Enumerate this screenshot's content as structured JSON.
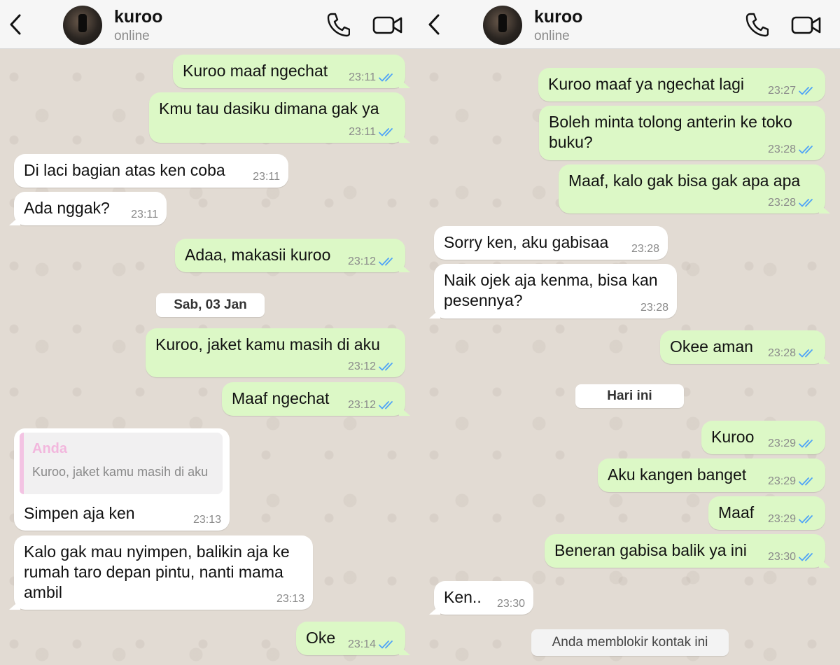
{
  "contact": {
    "name": "kuroo",
    "status": "online"
  },
  "icons": {
    "back": "chevron-left-icon",
    "call": "phone-icon",
    "video": "video-camera-icon",
    "read": "double-check-icon"
  },
  "colors": {
    "outgoing_bubble": "#dcf8c6",
    "incoming_bubble": "#ffffff",
    "read_ticks": "#4fa3f7",
    "quote_author": "#f2b7dd"
  },
  "left": {
    "date_chip": "Sab, 03 Jan",
    "messages": [
      {
        "text": "Kuroo maaf ngechat",
        "time": "23:11"
      },
      {
        "text": "Kmu tau dasiku dimana gak ya",
        "time": "23:11"
      },
      {
        "text": "Di laci bagian atas ken coba",
        "time": "23:11"
      },
      {
        "text": "Ada nggak?",
        "time": "23:11"
      },
      {
        "text": "Adaa, makasii kuroo",
        "time": "23:12"
      },
      {
        "text": "Kuroo, jaket kamu masih di aku",
        "time": "23:12"
      },
      {
        "text": "Maaf ngechat",
        "time": "23:12"
      },
      {
        "text": "Simpen aja ken",
        "time": "23:13",
        "quote_author": "Anda",
        "quote_text": "Kuroo, jaket kamu masih di aku"
      },
      {
        "lines": [
          "Kalo gak mau nyimpen, balikin aja ke",
          "rumah taro depan pintu, nanti mama",
          "ambil"
        ],
        "time": "23:13"
      },
      {
        "text": "Oke",
        "time": "23:14"
      }
    ]
  },
  "right": {
    "date_chip": "Hari ini",
    "system_notice": "Anda memblokir kontak ini",
    "messages": [
      {
        "text": "Kuroo maaf ya ngechat lagi",
        "time": "23:27"
      },
      {
        "lines": [
          "Boleh minta tolong anterin ke toko",
          "buku?"
        ],
        "time": "23:28"
      },
      {
        "text": "Maaf, kalo gak bisa gak apa apa",
        "time": "23:28"
      },
      {
        "text": "Sorry ken, aku gabisaa",
        "time": "23:28"
      },
      {
        "lines": [
          "Naik ojek aja kenma, bisa kan",
          "pesennya?"
        ],
        "time": "23:28"
      },
      {
        "text": "Okee aman",
        "time": "23:28"
      },
      {
        "text": "Kuroo",
        "time": "23:29"
      },
      {
        "text": "Aku kangen banget",
        "time": "23:29"
      },
      {
        "text": "Maaf",
        "time": "23:29"
      },
      {
        "text": "Beneran gabisa balik ya ini",
        "time": "23:30"
      },
      {
        "text": "Ken..",
        "time": "23:30"
      }
    ]
  }
}
